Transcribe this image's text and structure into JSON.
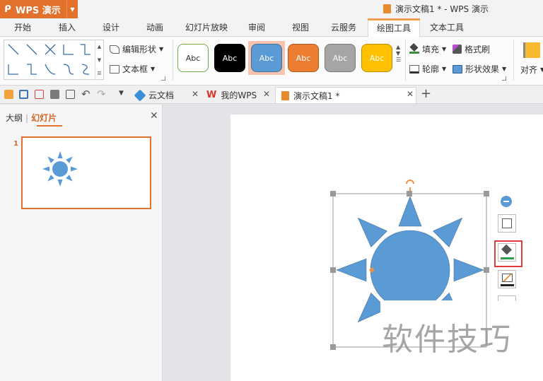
{
  "titlebar": {
    "app_name": "WPS 演示",
    "window_title": "演示文稿1 * - WPS 演示"
  },
  "tabs": [
    "开始",
    "插入",
    "设计",
    "动画",
    "幻灯片放映",
    "审阅",
    "视图",
    "云服务",
    "绘图工具",
    "文本工具"
  ],
  "active_tab": "绘图工具",
  "ribbon": {
    "edit_shape": "编辑形状",
    "textbox": "文本框",
    "style_label": "Abc",
    "fill": "填充",
    "format_painter": "格式刷",
    "outline": "轮廓",
    "shape_effect": "形状效果",
    "align": "对齐"
  },
  "doc_tabs": [
    "云文档",
    "我的WPS",
    "演示文稿1 *"
  ],
  "left_panel": {
    "tab_outline": "大纲",
    "tab_slides": "幻灯片",
    "slide_number": "1"
  },
  "watermark": "软件技巧",
  "colors": {
    "accent": "#e2712c",
    "shape_fill": "#5b9bd5",
    "highlight": "#e03b3b"
  }
}
